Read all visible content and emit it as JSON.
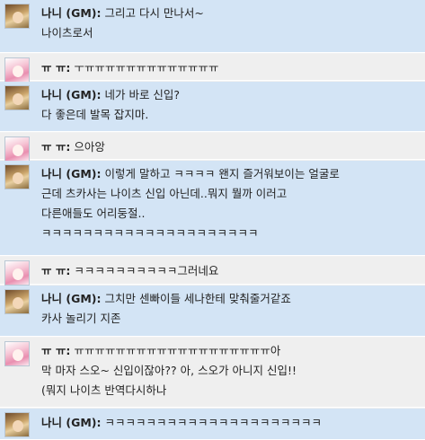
{
  "messages": [
    {
      "type": "gm",
      "name": "나니 (GM):",
      "lines": [
        "그리고 다시 만나서~",
        "나이츠로서"
      ]
    },
    {
      "type": "pp",
      "name": "ㅠ ㅠ:",
      "lines": [
        "ㅜㅠㅠㅠㅠㅠㅠㅠㅠㅠㅠㅠㅠㅠ"
      ]
    },
    {
      "type": "gm",
      "name": "나니 (GM):",
      "lines": [
        "네가 바로 신입?",
        "다 좋은데 발목 잡지마."
      ]
    },
    {
      "type": "pp",
      "name": "ㅠ ㅠ:",
      "lines": [
        "으아앙"
      ]
    },
    {
      "type": "gm",
      "name": "나니 (GM):",
      "lines": [
        "이렇게 말하고 ㅋㅋㅋㅋ 왠지 즐거워보이는 얼굴로",
        "근데 츠카사는 나이츠 신입 아닌데..뭐지 뭘까 이러고",
        "다른애들도 어리둥절..",
        "ㅋㅋㅋㅋㅋㅋㅋㅋㅋㅋㅋㅋㅋㅋㅋㅋㅋㅋㅋㅋㅋ"
      ]
    },
    {
      "type": "pp",
      "name": "ㅠ ㅠ:",
      "lines": [
        "ㅋㅋㅋㅋㅋㅋㅋㅋㅋㅋ그러네요"
      ]
    },
    {
      "type": "gm",
      "name": "나니 (GM):",
      "lines": [
        "그치만 센빠이들 세나한테 맞춰줄거같죠",
        "카사 놀리기 지존"
      ]
    },
    {
      "type": "pp",
      "name": "ㅠ ㅠ:",
      "lines": [
        "ㅠㅠㅠㅠㅠㅠㅠㅠㅠㅠㅠㅠㅠㅠㅠㅠㅠㅠㅠ아",
        "막 마자 스오~ 신입이잖아?? 아, 스오가 아니지 신입!!",
        "(뭐지 나이츠 반역다시하나"
      ]
    },
    {
      "type": "gm",
      "name": "나니 (GM):",
      "lines": [
        "ㅋㅋㅋㅋㅋㅋㅋㅋㅋㅋㅋㅋㅋㅋㅋㅋㅋㅋㅋㅋㅋ"
      ]
    }
  ],
  "icons": {
    "gm": "gm-avatar-icon",
    "pp": "pp-avatar-icon"
  },
  "colors": {
    "gm_bg": "#d3e4f5",
    "pp_bg": "#efefef"
  }
}
